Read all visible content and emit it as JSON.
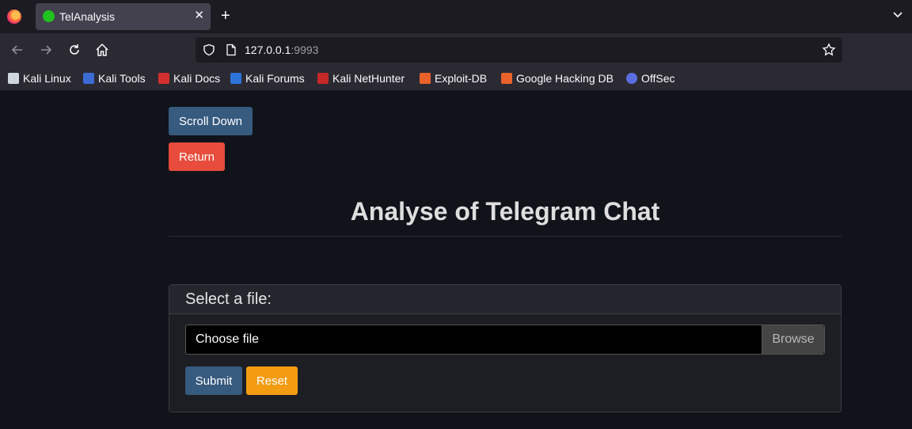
{
  "browser": {
    "tab_title": "TelAnalysis",
    "tab_close": "✕",
    "new_tab": "+",
    "url_host": "127.0.0.1",
    "url_port": ":9993",
    "bookmarks": [
      {
        "label": "Kali Linux",
        "color": "#cfd8dc",
        "icon": "kali-dragon-icon"
      },
      {
        "label": "Kali Tools",
        "color": "#3d6bd6",
        "icon": "kali-tools-icon"
      },
      {
        "label": "Kali Docs",
        "color": "#d32f2f",
        "icon": "kali-docs-icon"
      },
      {
        "label": "Kali Forums",
        "color": "#2e73d9",
        "icon": "kali-forums-icon"
      },
      {
        "label": "Kali NetHunter",
        "color": "#c62828",
        "icon": "kali-nethunter-icon"
      },
      {
        "label": "Exploit-DB",
        "color": "#e8622a",
        "icon": "exploit-db-icon"
      },
      {
        "label": "Google Hacking DB",
        "color": "#e8622a",
        "icon": "ghdb-icon"
      },
      {
        "label": "OffSec",
        "color": "#5b6ee1",
        "icon": "offsec-icon"
      }
    ]
  },
  "page": {
    "scroll_down_label": "Scroll Down",
    "return_label": "Return",
    "title": "Analyse of Telegram Chat",
    "form": {
      "header": "Select a file:",
      "file_placeholder": "Choose file",
      "browse_label": "Browse",
      "submit_label": "Submit",
      "reset_label": "Reset"
    }
  },
  "colors": {
    "primary": "#375a7f",
    "danger": "#e74c3c",
    "warning": "#f39c12"
  }
}
